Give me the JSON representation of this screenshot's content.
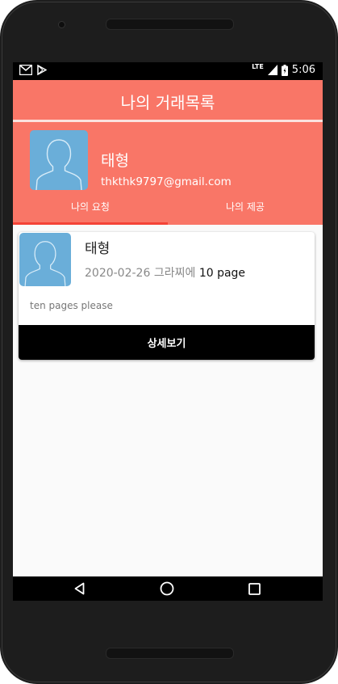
{
  "status_bar": {
    "time": "5:06",
    "network": "LTE"
  },
  "app_bar": {
    "title": "나의 거래목록"
  },
  "profile": {
    "name": "태형",
    "email": "thkthk9797@gmail.com"
  },
  "tabs": [
    {
      "label": "나의 요청",
      "selected": true
    },
    {
      "label": "나의 제공",
      "selected": false
    }
  ],
  "requests": [
    {
      "name": "태형",
      "date": "2020-02-26",
      "item": "그라찌에",
      "count": "10 page",
      "message": "ten pages please",
      "detail_label": "상세보기"
    }
  ],
  "colors": {
    "accent": "#f97667",
    "indicator": "#f44336",
    "avatar_bg": "#6aaed9"
  }
}
